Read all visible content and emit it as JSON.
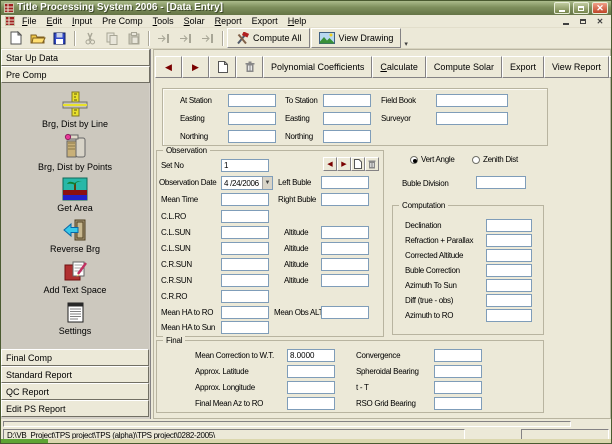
{
  "window": {
    "title": "Title Processing System 2006 - [Data Entry]"
  },
  "menu": {
    "items": [
      "File",
      "Edit",
      "Input",
      "Pre Comp",
      "Tools",
      "Solar",
      "Report",
      "Export",
      "Help"
    ]
  },
  "toolbar": {
    "compute_all_label": "Compute All",
    "view_drawing_label": "View Drawing"
  },
  "sidebar": {
    "top_tabs": [
      {
        "label": "Star Up Data"
      },
      {
        "label": "Pre Comp"
      }
    ],
    "tools": [
      {
        "label": "Brg, Dist by Line"
      },
      {
        "label": "Brg, Dist by Points"
      },
      {
        "label": "Get Area"
      },
      {
        "label": "Reverse Brg"
      },
      {
        "label": "Add Text Space"
      },
      {
        "label": "Settings"
      }
    ],
    "bottom_tabs": [
      {
        "label": "Final Comp"
      },
      {
        "label": "Standard Report"
      },
      {
        "label": "QC Report"
      },
      {
        "label": "Edit PS Report"
      }
    ]
  },
  "form_toolbar": {
    "polynomial": "Polynomial Coefficients",
    "calculate": "Calculate",
    "compute_solar": "Compute Solar",
    "export": "Export",
    "view_report": "View Report"
  },
  "station": {
    "at": {
      "label": "At Station",
      "value": ""
    },
    "at_easting": {
      "label": "Easting",
      "value": ""
    },
    "at_northing": {
      "label": "Northing",
      "value": ""
    },
    "to": {
      "label": "To Station",
      "value": ""
    },
    "to_easting": {
      "label": "Easting",
      "value": ""
    },
    "to_northing": {
      "label": "Northing",
      "value": ""
    },
    "field_book": {
      "label": "Field Book",
      "value": ""
    },
    "surveyor": {
      "label": "Surveyor",
      "value": ""
    }
  },
  "observation": {
    "title": "Observation",
    "rows": [
      {
        "l": "Set No",
        "lv": "1"
      },
      {
        "l": "Observation Date",
        "lv": "4 /24/2006",
        "r": "Left Buble",
        "rv": ""
      },
      {
        "l": "Mean Time",
        "lv": "",
        "r": "Right Buble",
        "rv": ""
      },
      {
        "l": "C.L.RO",
        "lv": ""
      },
      {
        "l": "C.L.SUN",
        "lv": "",
        "r": "Altitude",
        "rv": ""
      },
      {
        "l": "C.L.SUN",
        "lv": "",
        "r": "Altitude",
        "rv": ""
      },
      {
        "l": "C.R.SUN",
        "lv": "",
        "r": "Altitude",
        "rv": ""
      },
      {
        "l": "C.R.SUN",
        "lv": "",
        "r": "Altitude",
        "rv": ""
      },
      {
        "l": "C.R.RO",
        "lv": ""
      },
      {
        "l": "Mean HA to RO",
        "lv": "",
        "r": "Mean Obs ALT",
        "rv": ""
      },
      {
        "l": "Mean HA to Sun",
        "lv": ""
      }
    ]
  },
  "angle_mode": {
    "vert_label": "Vert Angle",
    "zenith_label": "Zenith Dist",
    "selected": "vert",
    "buble_division_label": "Buble Division",
    "buble_division_value": ""
  },
  "computation": {
    "title": "Computation",
    "rows": [
      {
        "label": "Declination",
        "value": ""
      },
      {
        "label": "Refraction + Parallax",
        "value": ""
      },
      {
        "label": "Corrected Altitude",
        "value": ""
      },
      {
        "label": "Buble Correction",
        "value": ""
      },
      {
        "label": "Azimuth To Sun",
        "value": ""
      },
      {
        "label": "Diff (true - obs)",
        "value": ""
      },
      {
        "label": "Azimuth to RO",
        "value": ""
      }
    ]
  },
  "final": {
    "title": "Final",
    "left": [
      {
        "label": "Mean Correction to W.T.",
        "value": "8.0000"
      },
      {
        "label": "Approx. Latitude",
        "value": ""
      },
      {
        "label": "Approx. Longitude",
        "value": ""
      },
      {
        "label": "Final Mean Az to RO",
        "value": ""
      }
    ],
    "right": [
      {
        "label": "Convergence",
        "value": ""
      },
      {
        "label": "Spheroidal Bearing",
        "value": ""
      },
      {
        "label": "t - T",
        "value": ""
      },
      {
        "label": "RSO Grid Bearing",
        "value": ""
      }
    ]
  },
  "statusbar": {
    "path": "D:\\VB_Project\\TPS project\\TPS (alpha)\\TPS project\\0282-2005\\"
  },
  "colors": {
    "titlebar": "#7E8F5C",
    "close_button": "#C04428",
    "window_bg": "#ECE9D8",
    "sidebar_bg": "#D4D0C8",
    "input_border": "#7F9DB9",
    "nav_arrow": "#7A0000",
    "start_sliver": "#5EA434"
  }
}
